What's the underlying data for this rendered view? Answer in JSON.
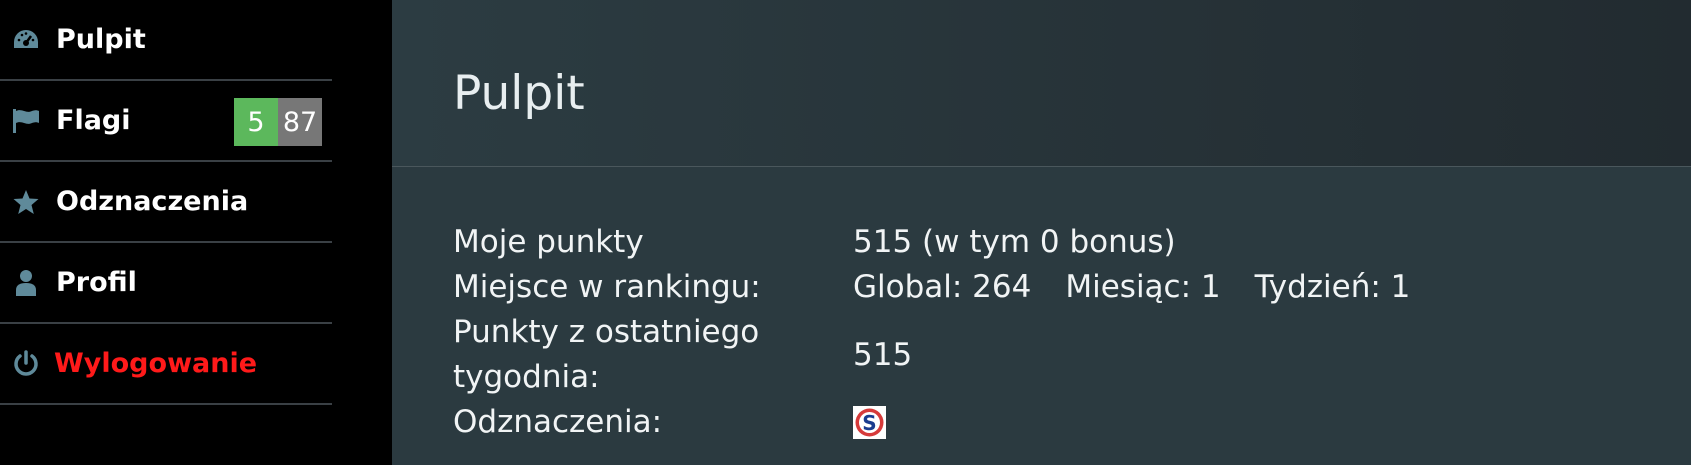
{
  "sidebar": {
    "items": [
      {
        "label": "Pulpit",
        "icon": "dashboard-icon"
      },
      {
        "label": "Flagi",
        "icon": "flag-icon",
        "badges": [
          "5",
          "87"
        ]
      },
      {
        "label": "Odznaczenia",
        "icon": "star-icon"
      },
      {
        "label": "Profil",
        "icon": "user-icon"
      },
      {
        "label": "Wylogowanie",
        "icon": "power-icon"
      }
    ]
  },
  "colors": {
    "sidebar_bg": "#000000",
    "main_bg": "#2b3a40",
    "badge_green": "#5cb85c",
    "badge_grey": "#777777",
    "logout_red": "#ff1a1a",
    "icon_color": "#5f8a9a"
  },
  "main": {
    "title": "Pulpit",
    "stats": {
      "points_label": "Moje punkty",
      "points_value": "515 (w tym 0 bonus)",
      "rank_label": "Miejsce w rankingu:",
      "rank_global": "Global: 264",
      "rank_month": "Miesiąc: 1",
      "rank_week": "Tydzień: 1",
      "week_points_label_line1": "Punkty z ostatniego",
      "week_points_label_line2": "tygodnia:",
      "week_points_value": "515",
      "badges_label": "Odznaczenia:",
      "badges_icon": "s-badge-icon"
    }
  }
}
